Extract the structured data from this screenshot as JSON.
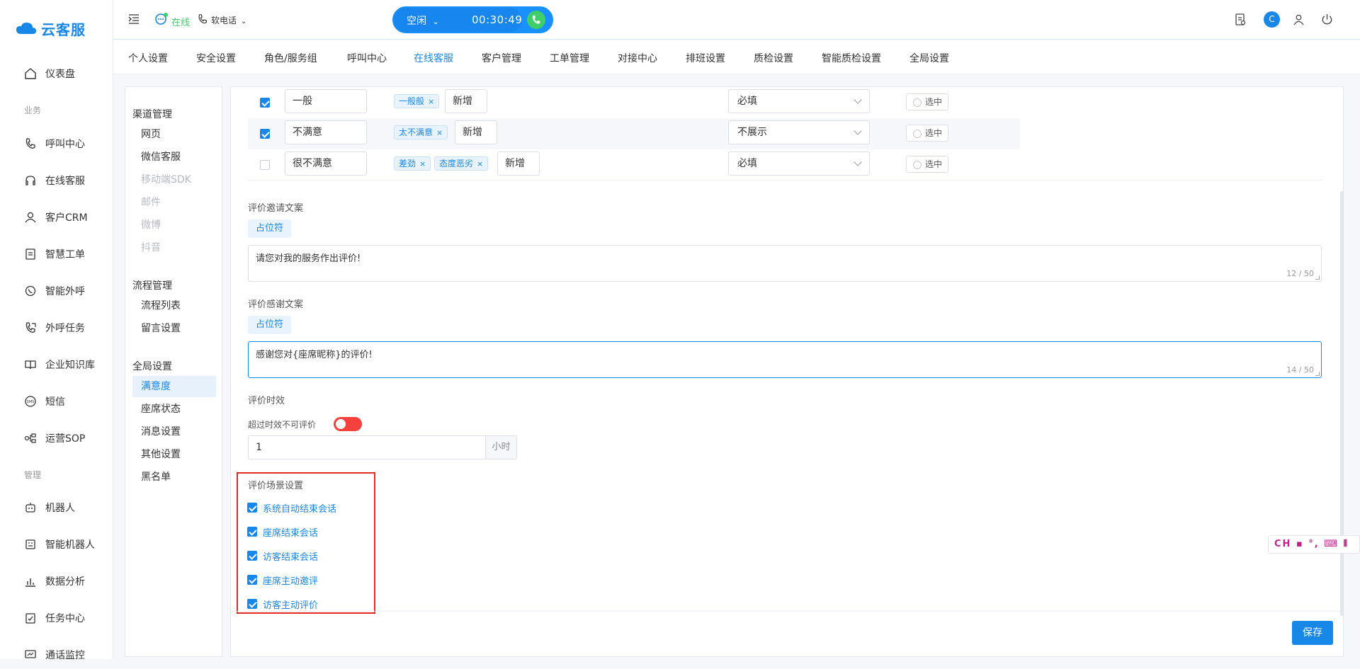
{
  "app": {
    "name": "云客服",
    "accent": "#1787e8"
  },
  "sidebar": {
    "items": [
      {
        "label": "仪表盘",
        "icon": "home-icon"
      },
      {
        "label": "呼叫中心",
        "icon": "phone-icon"
      },
      {
        "label": "在线客服",
        "icon": "headset-icon"
      },
      {
        "label": "客户CRM",
        "icon": "user-icon"
      },
      {
        "label": "智慧工单",
        "icon": "ticket-icon"
      },
      {
        "label": "智能外呼",
        "icon": "whatsapp-icon"
      },
      {
        "label": "外呼任务",
        "icon": "outbound-call-icon"
      },
      {
        "label": "企业知识库",
        "icon": "book-icon"
      },
      {
        "label": "短信",
        "icon": "sms-icon"
      },
      {
        "label": "运营SOP",
        "icon": "flow-icon"
      },
      {
        "label": "机器人",
        "icon": "robot-icon"
      },
      {
        "label": "智能机器人",
        "icon": "smart-robot-icon"
      },
      {
        "label": "数据分析",
        "icon": "bar-chart-icon"
      },
      {
        "label": "任务中心",
        "icon": "task-icon"
      },
      {
        "label": "通话监控",
        "icon": "monitor-icon"
      }
    ],
    "groups": {
      "business": "业务",
      "manage": "管理"
    }
  },
  "topbar": {
    "online_label": "在线",
    "softphone_label": "软电话",
    "status": "空闲",
    "timer": "00:30:49",
    "avatar_letter": "C"
  },
  "tabs": [
    "个人设置",
    "安全设置",
    "角色/服务组",
    "呼叫中心",
    "在线客服",
    "客户管理",
    "工单管理",
    "对接中心",
    "排班设置",
    "质检设置",
    "智能质检设置",
    "全局设置"
  ],
  "active_tab": "在线客服",
  "subnav": {
    "groups": [
      "渠道管理",
      "流程管理",
      "全局设置"
    ],
    "channel": [
      "网页",
      "微信客服",
      "移动端SDK",
      "邮件",
      "微博",
      "抖音"
    ],
    "flow": [
      "流程列表",
      "留言设置"
    ],
    "global": [
      "满意度",
      "座席状态",
      "消息设置",
      "其他设置",
      "黑名单"
    ]
  },
  "rating_rows": [
    {
      "checked": true,
      "name": "一般",
      "tags": [
        "一般般"
      ],
      "add_label": "新增",
      "select": "必填",
      "radio": "选中"
    },
    {
      "checked": true,
      "name": "不满意",
      "tags": [
        "太不满意"
      ],
      "add_label": "新增",
      "select": "不展示",
      "radio": "选中"
    },
    {
      "checked": false,
      "name": "很不满意",
      "tags": [
        "差劲",
        "态度恶劣"
      ],
      "add_label": "新增",
      "select": "必填",
      "radio": "选中"
    }
  ],
  "invite": {
    "label": "评价邀请文案",
    "placeholder_btn": "占位符",
    "text": "请您对我的服务作出评价!",
    "count": "12 / 50"
  },
  "thanks": {
    "label": "评价感谢文案",
    "placeholder_btn": "占位符",
    "text": "感谢您对{座席昵称}的评价!",
    "count": "14 / 50"
  },
  "timeliness": {
    "label": "评价时效",
    "toggle_label": "超过时效不可评价",
    "toggle_on": false,
    "value": "1",
    "unit": "小时"
  },
  "scene": {
    "title": "评价场景设置",
    "options": [
      "系统自动结束会话",
      "座席结束会话",
      "访客结束会话",
      "座席主动邀评",
      "访客主动评价"
    ]
  },
  "save_label": "保存",
  "ime_text": "CH"
}
